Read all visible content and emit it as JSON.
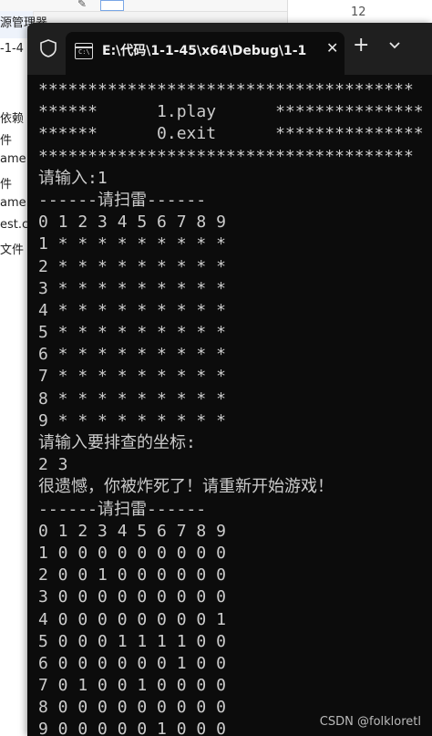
{
  "background": {
    "toolbar_number": "12",
    "left_fragments": [
      "源管理器",
      "-1-4",
      "依赖",
      "件",
      "ame",
      "件",
      "ame",
      "est.c",
      "文件"
    ]
  },
  "window": {
    "tab_title": "E:\\代码\\1-1-45\\x64\\Debug\\1-1",
    "close_glyph": "✕",
    "new_tab_glyph": "+"
  },
  "console": {
    "lines": [
      "**************************************",
      "******      1.play      ***************",
      "******      0.exit      ***************",
      "**************************************",
      "请输入:1",
      "------请扫雷------",
      "0 1 2 3 4 5 6 7 8 9",
      "1 * * * * * * * * *",
      "2 * * * * * * * * *",
      "3 * * * * * * * * *",
      "4 * * * * * * * * *",
      "5 * * * * * * * * *",
      "6 * * * * * * * * *",
      "7 * * * * * * * * *",
      "8 * * * * * * * * *",
      "9 * * * * * * * * *",
      "请输入要排查的坐标:",
      "2 3",
      "很遗憾，你被炸死了！请重新开始游戏！",
      "------请扫雷------",
      "0 1 2 3 4 5 6 7 8 9",
      "1 0 0 0 0 0 0 0 0 0",
      "2 0 0 1 0 0 0 0 0 0",
      "3 0 0 0 0 0 0 0 0 0",
      "4 0 0 0 0 0 0 0 0 1",
      "5 0 0 0 1 1 1 1 0 0",
      "6 0 0 0 0 0 0 1 0 0",
      "7 0 1 0 0 1 0 0 0 0",
      "8 0 0 0 0 0 0 0 0 0",
      "9 0 0 0 0 0 1 0 0 0"
    ]
  },
  "watermark": "CSDN @folkloretl"
}
